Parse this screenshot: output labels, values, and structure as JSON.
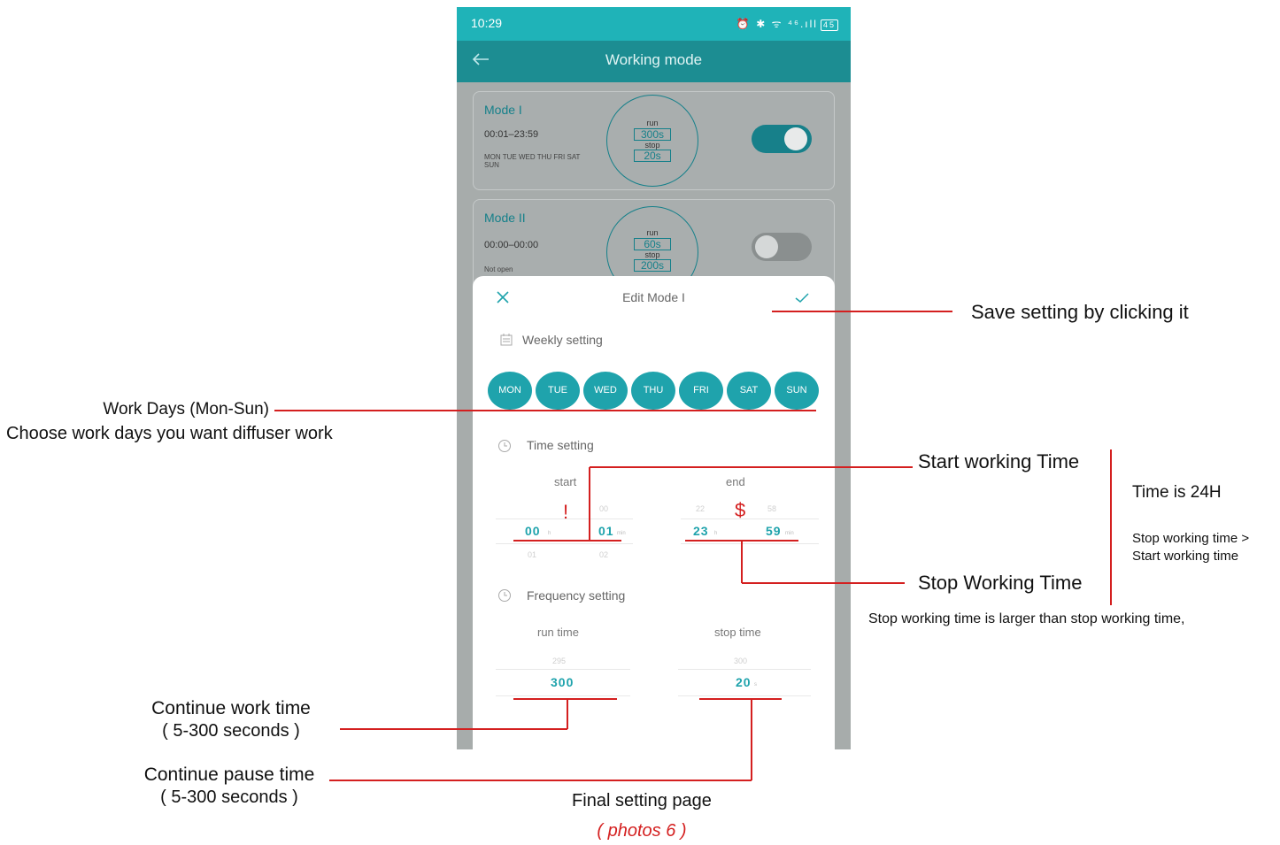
{
  "status_bar": {
    "time": "10:29",
    "icons": "⏰ ✱ ᯤ ⁴⁶.ıll",
    "battery": "45"
  },
  "nav": {
    "title": "Working mode"
  },
  "modes": [
    {
      "name": "Mode I",
      "time": "00:01–23:59",
      "days": "MON TUE WED THU FRI SAT SUN",
      "run_label": "run",
      "run_value": "300s",
      "stop_label": "stop",
      "stop_value": "20s",
      "enabled": true
    },
    {
      "name": "Mode II",
      "time": "00:00–00:00",
      "days": "Not open",
      "run_label": "run",
      "run_value": "60s",
      "stop_label": "stop",
      "stop_value": "200s",
      "enabled": false
    }
  ],
  "modal": {
    "title": "Edit Mode I",
    "weekly_label": "Weekly setting",
    "days": [
      "MON",
      "TUE",
      "WED",
      "THU",
      "FRI",
      "SAT",
      "SUN"
    ],
    "time_label": "Time setting",
    "start_label": "start",
    "end_label": "end",
    "start_prev_minute": "00",
    "start_hour": "00",
    "start_minute": "01",
    "start_next_hour": "01",
    "start_next_minute": "02",
    "end_prev_hour": "22",
    "end_prev_minute": "58",
    "end_hour": "23",
    "end_minute": "59",
    "hour_unit": "h",
    "minute_unit": "min",
    "frequency_label": "Frequency setting",
    "run_time_label": "run time",
    "stop_time_label": "stop time",
    "run_prev": "295",
    "run_value": "300",
    "stop_prev": "300",
    "stop_value": "20",
    "seconds_unit": "s"
  },
  "annotations": {
    "save": "Save setting by clicking it",
    "work_days_title": "Work Days (Mon-Sun)",
    "work_days_desc": "Choose work days you want diffuser work",
    "start_time": "Start working Time",
    "time_24h": "Time is 24H",
    "stop_gt_start_1": "Stop working time >",
    "stop_gt_start_2": "Start working time",
    "stop_time": "Stop Working Time",
    "stop_larger": "Stop working time is larger than stop working time,",
    "continue_work_1": "Continue work time",
    "continue_work_2": "( 5-300 seconds )",
    "continue_pause_1": "Continue pause time",
    "continue_pause_2": "( 5-300 seconds )",
    "final": "Final setting page",
    "photos": "( photos 6 )",
    "mark_exclaim": "!",
    "mark_dollar": "$"
  },
  "colors": {
    "teal": "#1fb3b8",
    "dark_teal": "#1c8d92",
    "day_fill": "#1fa3ac",
    "annotation_red": "#d41f1f"
  }
}
